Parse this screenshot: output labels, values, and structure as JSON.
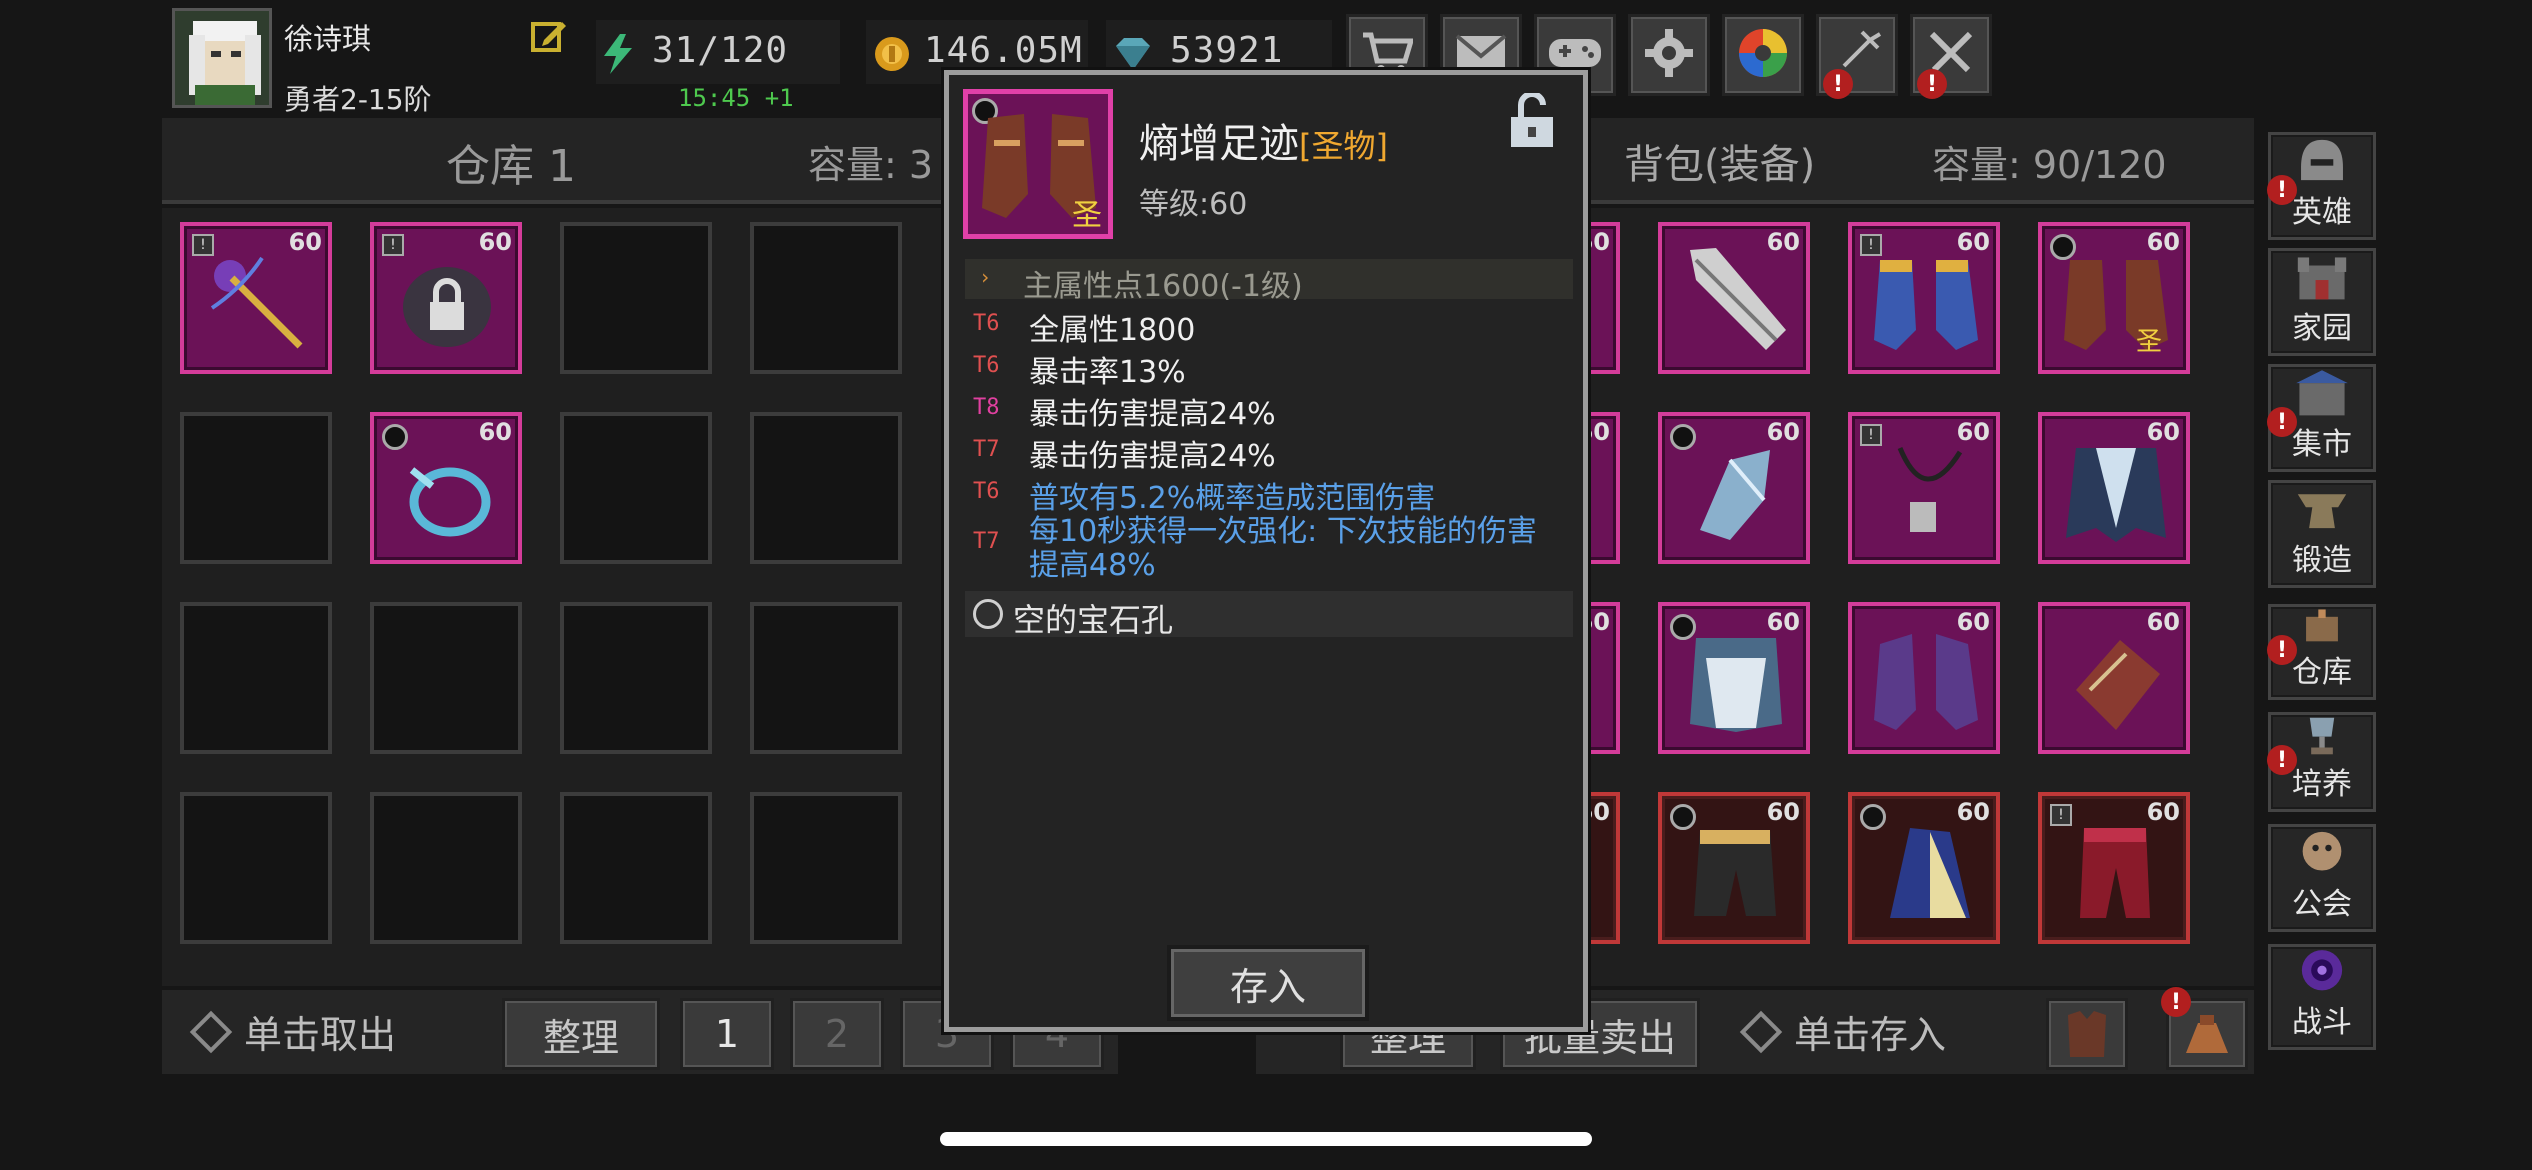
{
  "player": {
    "name": "徐诗琪",
    "rank": "勇者2-15阶"
  },
  "resources": {
    "energy": "31/120",
    "energy_timer": "15:45 +1",
    "gold": "146.05M",
    "gems": "53921"
  },
  "top_icons": [
    "shop-cart-icon",
    "mail-icon",
    "gamepad-icon",
    "gear-icon",
    "color-wheel-icon",
    "fireworks-icon",
    "crossed-swords-icon"
  ],
  "warehouse": {
    "title": "仓库 1",
    "capacity_label": "容量: 3",
    "sort_button": "整理",
    "take_out_hint": "单击取出",
    "pages": [
      "1",
      "2",
      "3",
      "4"
    ],
    "slots": [
      {
        "level": "60",
        "item": "purple-staff-icon",
        "lock": true
      },
      {
        "level": "60",
        "item": "locked-orb-icon",
        "lock": true
      },
      {
        "level": "",
        "item": ""
      },
      {
        "level": "",
        "item": ""
      },
      {
        "level": "",
        "item": ""
      },
      {
        "level": "60",
        "item": "blue-ring-icon",
        "circle": true
      },
      {
        "level": "",
        "item": ""
      },
      {
        "level": "",
        "item": ""
      }
    ]
  },
  "backpack": {
    "title": "背包(装备)",
    "capacity_label": "容量: 90/120",
    "sort_button": "整理",
    "bulk_sell_button": "批量卖出",
    "store_hint": "单击存入",
    "slot_levels": [
      "60",
      "60",
      "60",
      "60",
      "60",
      "60",
      "60",
      "60",
      "60",
      "60",
      "60",
      "60",
      "60",
      "60",
      "60",
      "60"
    ]
  },
  "side_nav": [
    {
      "label": "英雄",
      "icon": "helmet-icon",
      "alert": true
    },
    {
      "label": "家园",
      "icon": "castle-icon",
      "alert": false
    },
    {
      "label": "集市",
      "icon": "market-icon",
      "alert": true
    },
    {
      "label": "锻造",
      "icon": "anvil-icon",
      "alert": false
    },
    {
      "label": "仓库",
      "icon": "warehouse-icon",
      "alert": true
    },
    {
      "label": "培养",
      "icon": "trophy-icon",
      "alert": true
    },
    {
      "label": "公会",
      "icon": "guild-icon",
      "alert": false
    },
    {
      "label": "战斗",
      "icon": "portal-icon",
      "alert": false
    }
  ],
  "tooltip": {
    "item_name": "熵增足迹",
    "item_tag": "[圣物]",
    "item_level": "等级:60",
    "main_stat": "主属性点1600(-1级)",
    "affixes": [
      {
        "tier": "T6",
        "text": "全属性1800",
        "tier_color": "#e05050",
        "text_color": "#f0f0f0"
      },
      {
        "tier": "T6",
        "text": "暴击率13%",
        "tier_color": "#e05050",
        "text_color": "#f0f0f0"
      },
      {
        "tier": "T8",
        "text": "暴击伤害提高24%",
        "tier_color": "#e040a0",
        "text_color": "#f0f0f0"
      },
      {
        "tier": "T7",
        "text": "暴击伤害提高24%",
        "tier_color": "#e05050",
        "text_color": "#f0f0f0"
      },
      {
        "tier": "T6",
        "text": "普攻有5.2%概率造成范围伤害",
        "tier_color": "#e05050",
        "text_color": "#5aa0e8"
      },
      {
        "tier": "T7",
        "text": "每10秒获得一次强化: 下次技能的伤害提高48%",
        "tier_color": "#e05050",
        "text_color": "#5aa0e8"
      }
    ],
    "gem_slot": "空的宝石孔",
    "store_button": "存入",
    "icon_badge": "圣"
  },
  "colors": {
    "slot_legendary": "#6b1257",
    "slot_legendary_border": "#d43c9a",
    "slot_red_border": "#c03838",
    "tag_gold": "#f0a830",
    "timer_green": "#4ec94e",
    "alert_red": "#b21f1f"
  }
}
